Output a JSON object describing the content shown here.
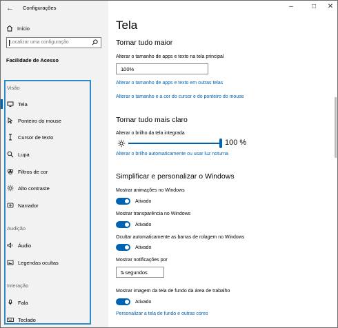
{
  "titlebar": {
    "back_icon": "back-arrow-icon",
    "app_title": "Configurações",
    "controls": [
      "minimize-icon",
      "maximize-icon",
      "close-icon"
    ]
  },
  "sidebar": {
    "home_label": "Início",
    "search_placeholder": "Localizar uma configuração",
    "category_title": "Facilidade de Acesso",
    "groups": [
      {
        "label": "Visão",
        "items": [
          {
            "label": "Tela",
            "icon": "display-icon",
            "selected": true
          },
          {
            "label": "Ponteiro do mouse",
            "icon": "mouse-pointer-icon"
          },
          {
            "label": "Cursor de texto",
            "icon": "text-cursor-icon"
          },
          {
            "label": "Lupa",
            "icon": "magnifier-icon"
          },
          {
            "label": "Filtros de cor",
            "icon": "color-filter-icon"
          },
          {
            "label": "Alto contraste",
            "icon": "high-contrast-icon"
          },
          {
            "label": "Narrador",
            "icon": "narrator-icon"
          }
        ]
      },
      {
        "label": "Audição",
        "items": [
          {
            "label": "Áudio",
            "icon": "speaker-icon"
          },
          {
            "label": "Legendas ocultas",
            "icon": "captions-icon"
          }
        ]
      },
      {
        "label": "Interação",
        "items": [
          {
            "label": "Fala",
            "icon": "microphone-icon"
          },
          {
            "label": "Teclado",
            "icon": "keyboard-icon"
          }
        ]
      }
    ]
  },
  "main": {
    "page_title": "Tela",
    "section1": {
      "title": "Tornar tudo maior",
      "size_label": "Alterar o tamanho de apps e texto na tela principal",
      "size_value": "100%",
      "link1": "Alterar o tamanho de apps e texto em outras telas",
      "link2": "Alterar o tamanho e a cor do cursor e do ponteiro do mouse"
    },
    "section2": {
      "title": "Tornar tudo mais claro",
      "brightness_label": "Alterar o brilho da tela integrada",
      "brightness_value": 100,
      "brightness_text": "100 %",
      "link": "Alterar o brilho automaticamente ou usar luz noturna"
    },
    "section3": {
      "title": "Simplificar e personalizar o Windows",
      "t1_label": "Mostrar animações no Windows",
      "t1_state": "Ativado",
      "t2_label": "Mostrar transparência no Windows",
      "t2_state": "Ativado",
      "t3_label": "Ocultar automaticamente as barras de rolagem no Windows",
      "t3_state": "Ativado",
      "notif_label": "Mostrar notificações por",
      "notif_value": "5 segundos",
      "t4_label": "Mostrar imagem da tela de fundo da área de trabalho",
      "t4_state": "Ativado",
      "link": "Personalizar a tela de fundo e outras cores"
    }
  },
  "colors": {
    "accent": "#0063b1",
    "highlight_border": "#2e8bc9",
    "sidebar_bg": "#f2f2f2"
  }
}
